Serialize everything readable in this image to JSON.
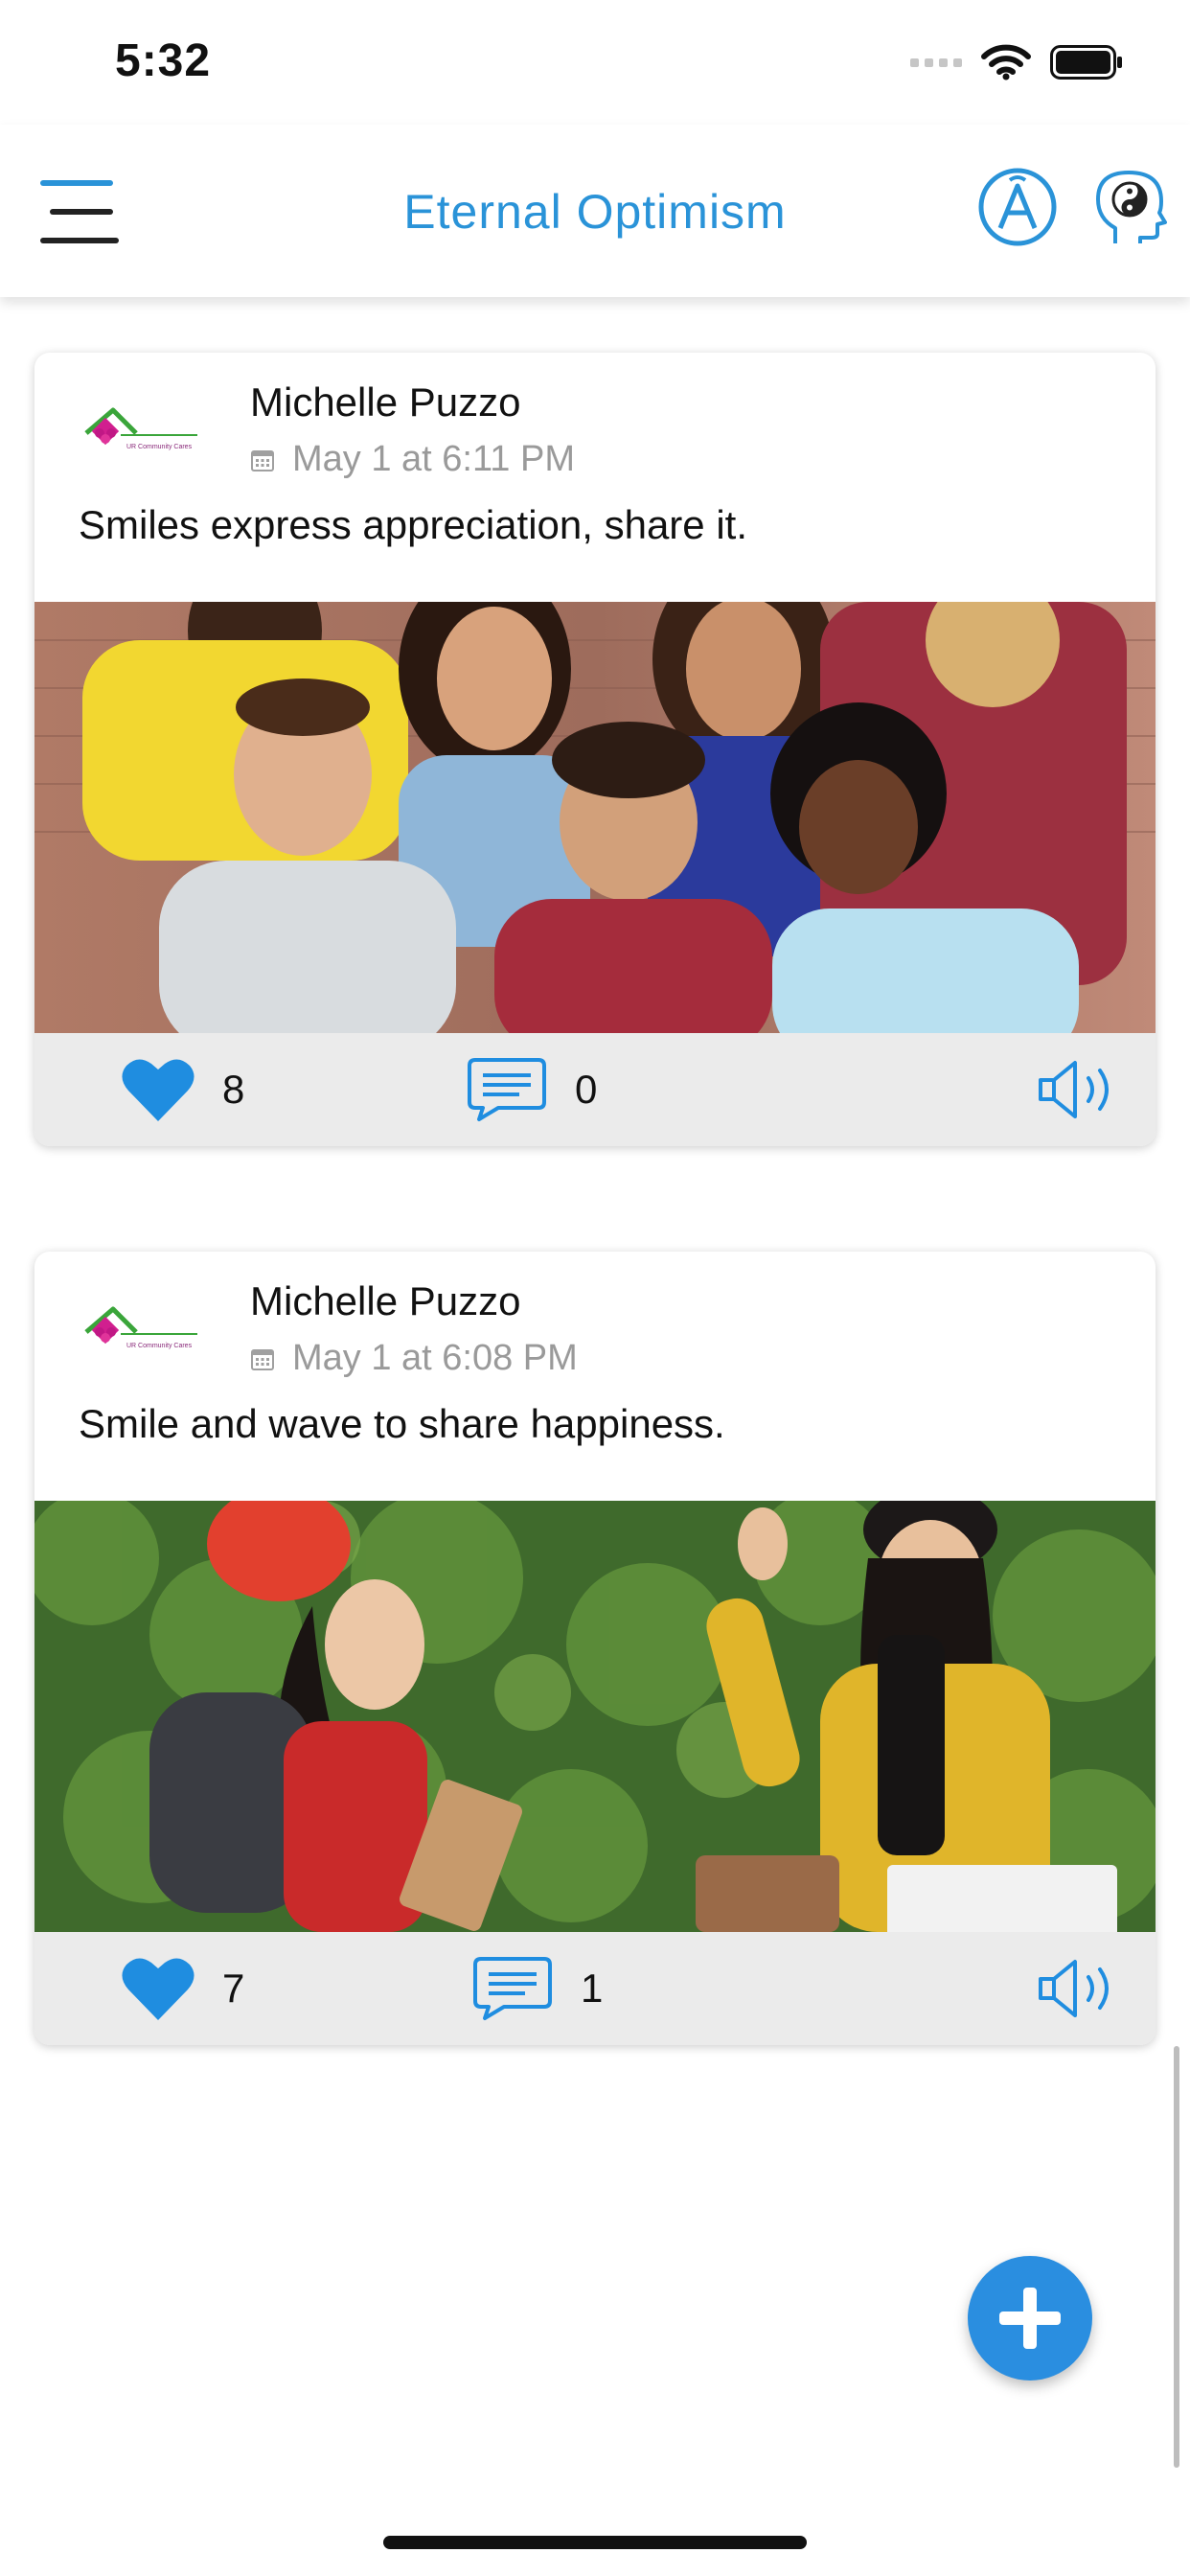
{
  "status_bar": {
    "time": "5:32"
  },
  "header": {
    "title": "Eternal Optimism",
    "icons": [
      "menu-icon",
      "font-a-icon",
      "head-yin-yang-icon"
    ]
  },
  "posts": [
    {
      "author": "Michelle Puzzo",
      "date": "May 1 at 6:11 PM",
      "text": "Smiles express appreciation, share it.",
      "likes": "8",
      "comments": "0",
      "image": "group-of-smiling-friends-photo"
    },
    {
      "author": "Michelle Puzzo",
      "date": "May 1 at 6:08 PM",
      "text": "Smile and wave to share happiness.",
      "likes": "7",
      "comments": "1",
      "image": "two-women-waving-photo"
    }
  ],
  "colors": {
    "accent": "#2a93d8",
    "fab": "#2a8ee0",
    "action_bar": "#ebebeb"
  }
}
